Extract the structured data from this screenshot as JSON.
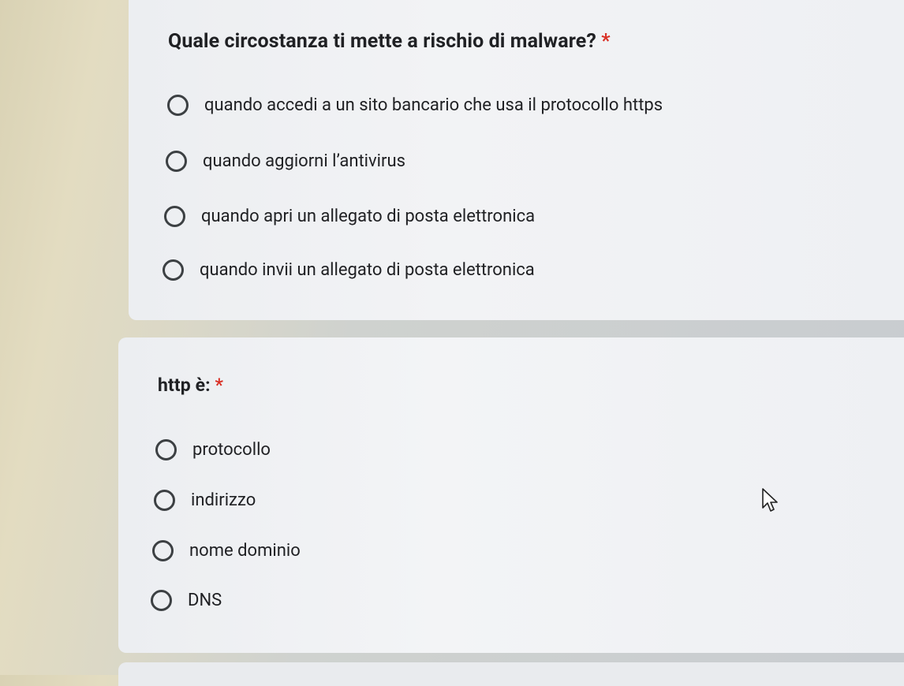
{
  "question1": {
    "title": "Quale circostanza ti mette a rischio di malware?",
    "required_mark": "*",
    "options": [
      "quando accedi a un sito bancario che usa il protocollo https",
      "quando aggiorni l’antivirus",
      "quando apri un allegato di posta elettronica",
      "quando invii un allegato di posta elettronica"
    ]
  },
  "question2": {
    "title": "http è:",
    "required_mark": "*",
    "options": [
      "protocollo",
      "indirizzo",
      "nome dominio",
      "DNS"
    ]
  },
  "colors": {
    "required": "#d93025",
    "text": "#202124",
    "radio_border": "#3c4043"
  },
  "icons": [
    "radio-unchecked-icon",
    "mouse-pointer-icon"
  ]
}
